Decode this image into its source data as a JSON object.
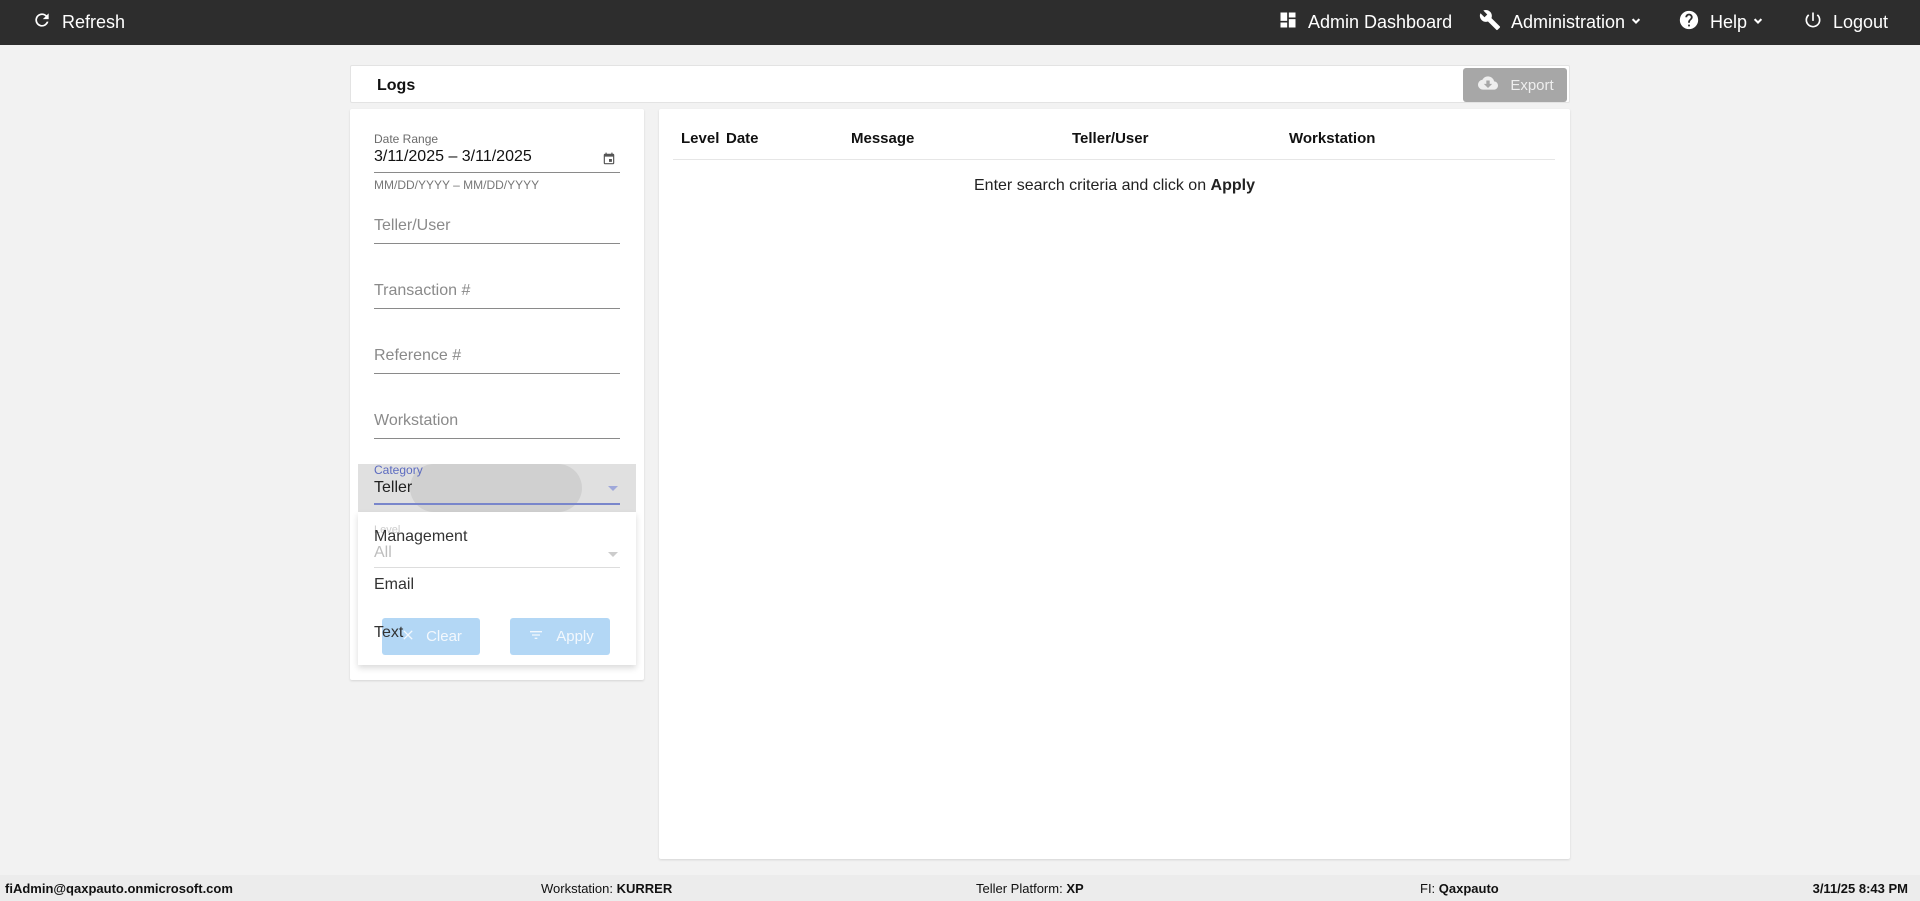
{
  "topbar": {
    "refresh_label": "Refresh",
    "admin_dashboard_label": "Admin Dashboard",
    "administration_label": "Administration",
    "help_label": "Help",
    "logout_label": "Logout",
    "icons": [
      "refresh-icon",
      "dashboard-icon",
      "wrench-icon",
      "help-icon",
      "power-icon"
    ]
  },
  "logs_header": {
    "title": "Logs",
    "export_label": "Export"
  },
  "filters": {
    "date_range": {
      "label": "Date Range",
      "value": "3/11/2025 – 3/11/2025",
      "hint": "MM/DD/YYYY – MM/DD/YYYY"
    },
    "teller_user_placeholder": "Teller/User",
    "transaction_placeholder": "Transaction #",
    "reference_placeholder": "Reference #",
    "workstation_placeholder": "Workstation",
    "category": {
      "label": "Category",
      "selected": "Teller",
      "options": [
        "Management",
        "Email",
        "Text"
      ]
    },
    "level": {
      "label": "Level",
      "selected": "All"
    },
    "clear_label": "Clear",
    "apply_label": "Apply"
  },
  "results": {
    "columns": [
      "Level",
      "Date",
      "Message",
      "Teller/User",
      "Workstation"
    ],
    "empty_prefix": "Enter search criteria and click on ",
    "empty_emphasis": "Apply"
  },
  "footer": {
    "user": "fiAdmin@qaxpauto.onmicrosoft.com",
    "workstation_label": "Workstation: ",
    "workstation_value": "KURRER",
    "platform_label": "Teller Platform: ",
    "platform_value": "XP",
    "fi_label": "FI: ",
    "fi_value": "Qaxpauto",
    "datetime": "3/11/25 8:43 PM"
  },
  "colors": {
    "topbar": "#2d2d2d",
    "category_accent": "#5c6bc0",
    "button_disabled": "#b3d7f5",
    "export_disabled": "#a7a7a7"
  }
}
